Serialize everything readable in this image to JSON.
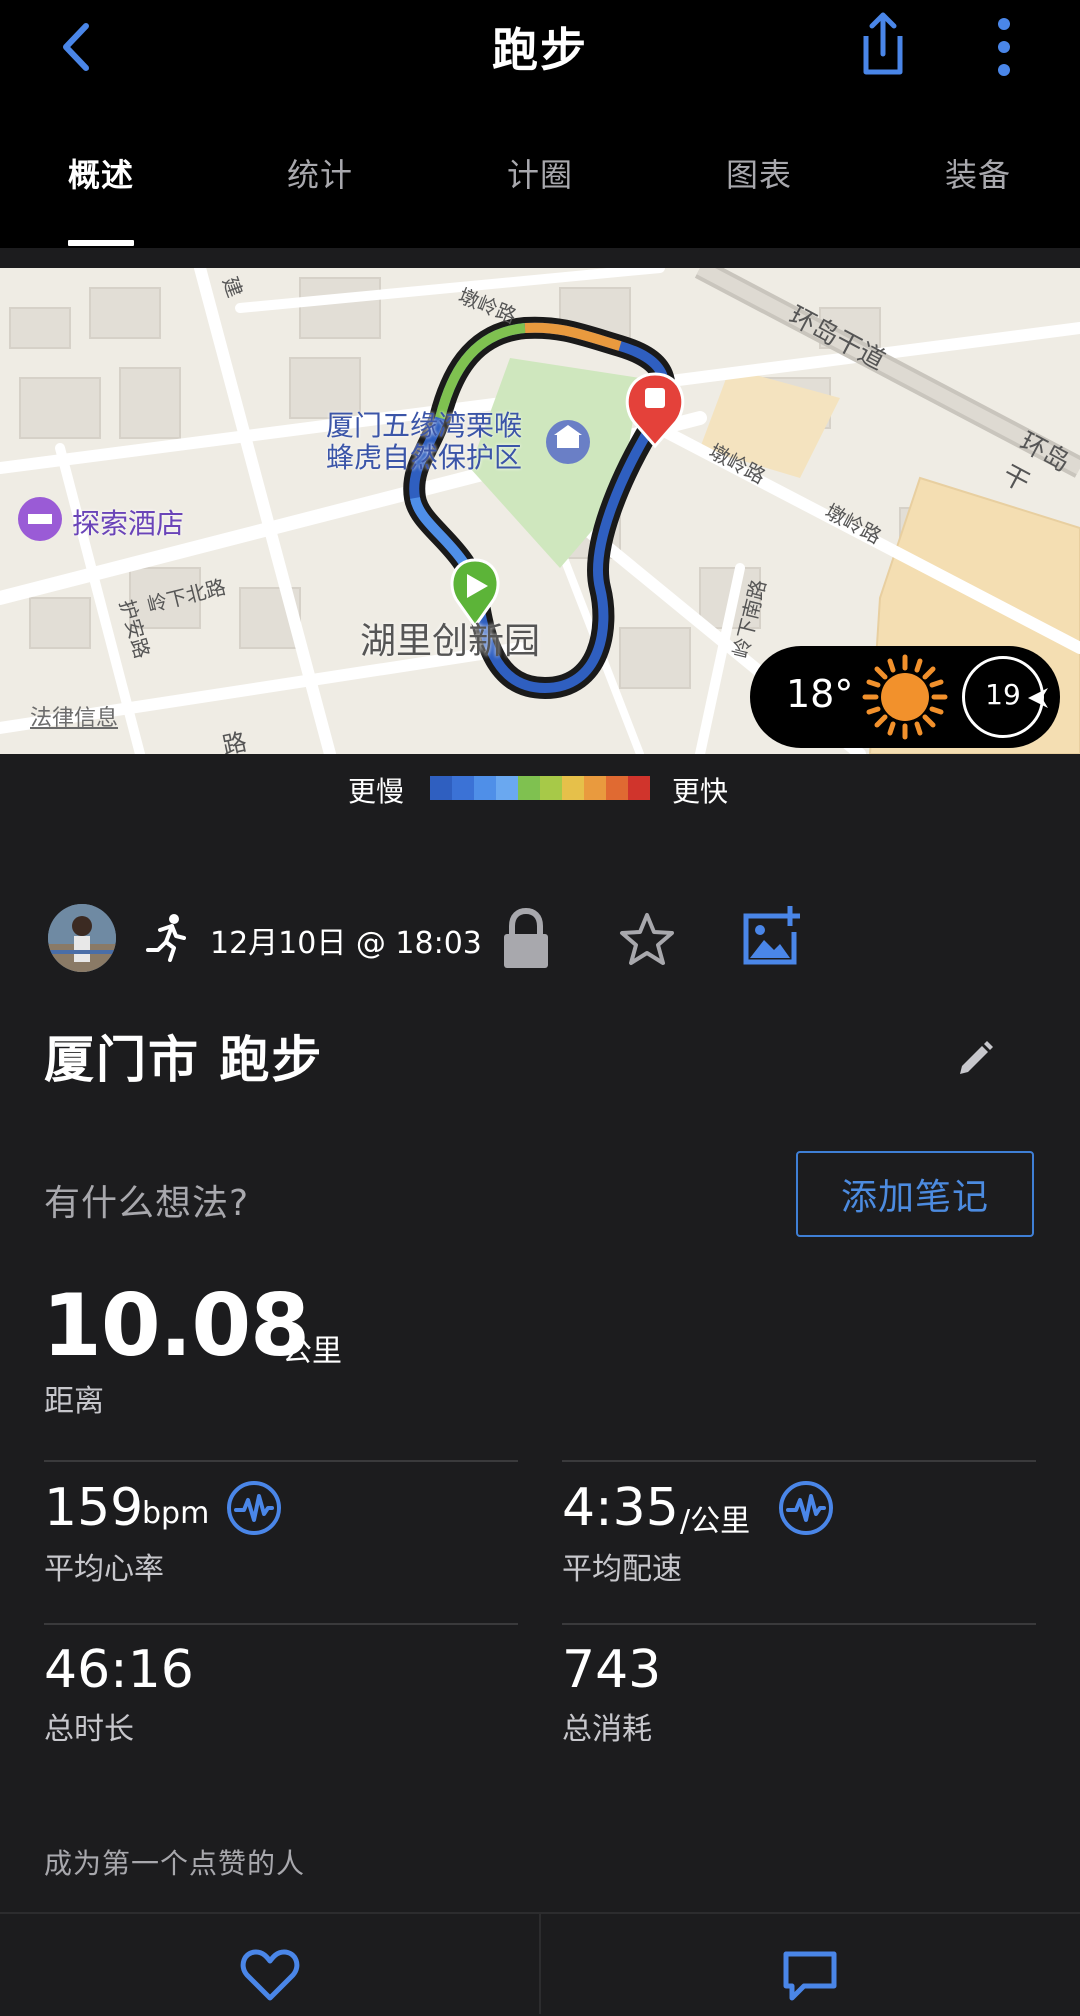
{
  "header": {
    "title": "跑步",
    "back_icon": "chevron-left-icon",
    "share_icon": "share-icon",
    "more_icon": "more-vertical-icon",
    "accent_color": "#4a86e8"
  },
  "tabs": [
    {
      "label": "概述",
      "active": true
    },
    {
      "label": "统计",
      "active": false
    },
    {
      "label": "计圈",
      "active": false
    },
    {
      "label": "图表",
      "active": false
    },
    {
      "label": "装备",
      "active": false
    }
  ],
  "map": {
    "labels": {
      "park_line1": "厦门五缘湾栗喉",
      "park_line2": "蜂虎自然保护区",
      "hotel": "探索酒店",
      "innovation_park": "湖里创新园",
      "road_dunling1": "墩岭路",
      "road_dunling2": "墩岭路",
      "road_dunling3": "墩岭路",
      "road_huandao": "环岛干道",
      "road_huandao2": "环岛干",
      "road_lingxiabei": "岭下北路",
      "road_huan": "护安路",
      "road_lingxianan": "岭下南路",
      "road_jian": "建",
      "road_lu": "路"
    },
    "legal": "法律信息",
    "weather": {
      "temperature": "18°",
      "icon": "sun-icon",
      "wind_speed": "19"
    }
  },
  "legend": {
    "slow": "更慢",
    "fast": "更快",
    "colors": [
      "#2f5fc0",
      "#3b72d6",
      "#4f8fe8",
      "#6aa8f0",
      "#7fc150",
      "#a7c948",
      "#e6c04a",
      "#e99a3e",
      "#e06a32",
      "#d0342c"
    ]
  },
  "activity": {
    "datetime": "12月10日 @ 18:03",
    "activity_type_icon": "running-person-icon",
    "privacy_icon": "lock-icon",
    "favorite_icon": "star-icon",
    "add_photo_icon": "add-photo-icon",
    "name": "厦门市 跑步",
    "edit_icon": "pencil-icon",
    "thoughts_placeholder": "有什么想法?",
    "add_note_label": "添加笔记"
  },
  "stats": {
    "distance": {
      "value": "10.08",
      "unit": "公里",
      "label": "距离"
    },
    "heart_rate": {
      "value": "159",
      "unit": "bpm",
      "label": "平均心率",
      "icon": "heart-rate-wave-icon"
    },
    "pace": {
      "value": "4:35",
      "unit": "/公里",
      "label": "平均配速",
      "icon": "pace-wave-icon"
    },
    "duration": {
      "value": "46:16",
      "label": "总时长"
    },
    "calories": {
      "value": "743",
      "label": "总消耗"
    }
  },
  "social": {
    "likes_text": "成为第一个点赞的人",
    "like_icon": "heart-icon",
    "comment_icon": "comment-icon"
  }
}
